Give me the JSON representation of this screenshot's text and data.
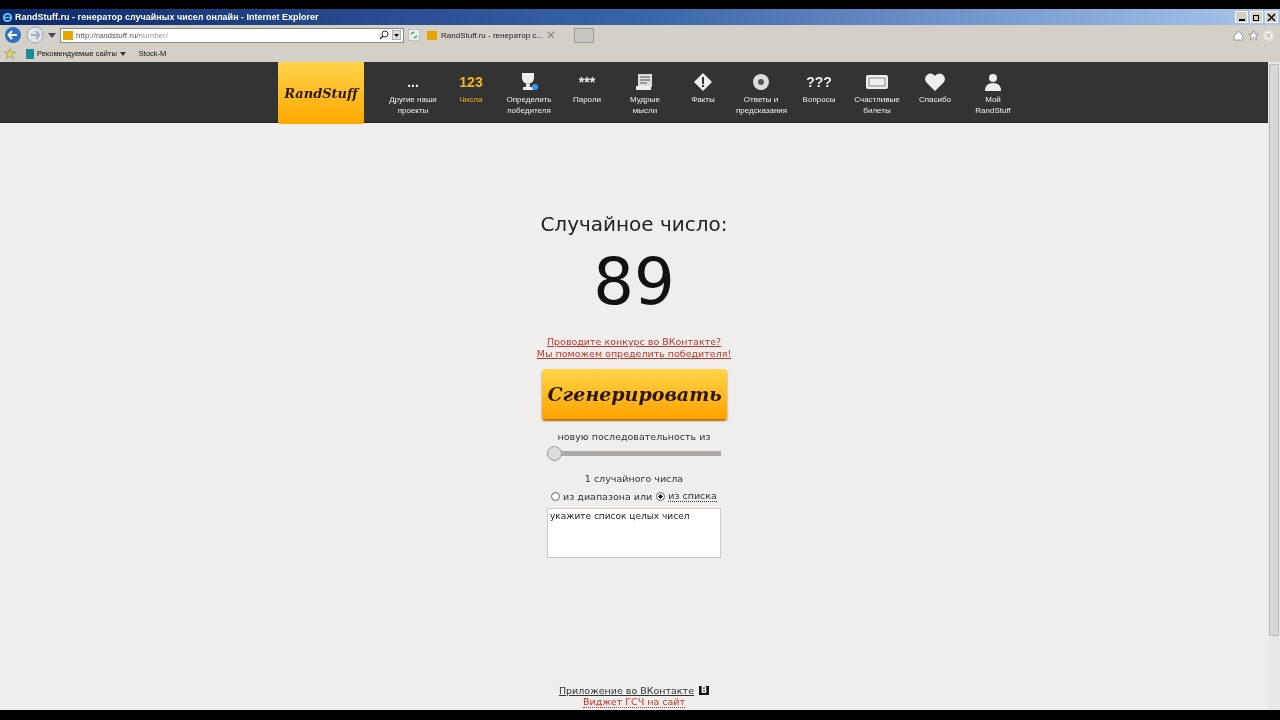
{
  "window": {
    "title": "RandStuff.ru - генератор случайных чисел онлайн - Internet Explorer"
  },
  "address_bar": {
    "host": "http://randstuff.ru/",
    "path": "number/"
  },
  "tab": {
    "label": "RandStuff.ru - генератор с..."
  },
  "favorites": [
    {
      "label": "Рекомендуемые сайты",
      "dropdown": true
    },
    {
      "label": "Stock-M",
      "dropdown": false
    }
  ],
  "site": {
    "logo": "RandStuff",
    "nav": [
      {
        "label": "Другие наши проекты",
        "glyph": "...",
        "selected": false
      },
      {
        "label": "Числа",
        "glyph": "123",
        "selected": true
      },
      {
        "label": "Определить победителя",
        "selected": false
      },
      {
        "label": "Пароли",
        "glyph": "***",
        "selected": false
      },
      {
        "label": "Мудрые мысли",
        "selected": false
      },
      {
        "label": "Факты",
        "selected": false
      },
      {
        "label": "Ответы и предсказания",
        "selected": false
      },
      {
        "label": "Вопросы",
        "glyph": "???",
        "selected": false
      },
      {
        "label": "Счастливые билеты",
        "selected": false
      },
      {
        "label": "Спасибо",
        "selected": false
      },
      {
        "label": "Мой RandStuff",
        "selected": false
      }
    ]
  },
  "result": {
    "heading": "Случайное число:",
    "number": "89"
  },
  "promo_links": [
    "Проводите конкурс во ВКонтакте?",
    "Мы поможем определить победителя!"
  ],
  "generate_button": "Сгенерировать",
  "sequence": {
    "label": "новую последовательность из",
    "level": 0,
    "count_text": "1 случайного числа"
  },
  "source": [
    {
      "label": "из диапазона или",
      "selected": false
    },
    {
      "label": "из списка",
      "selected": true
    }
  ],
  "list_field": {
    "placeholder": "укажите список целых чисел"
  },
  "footer": {
    "app_link": "Приложение во ВКонтакте",
    "badge": "В",
    "widget_link": "Виджет ГСЧ на сайт"
  }
}
